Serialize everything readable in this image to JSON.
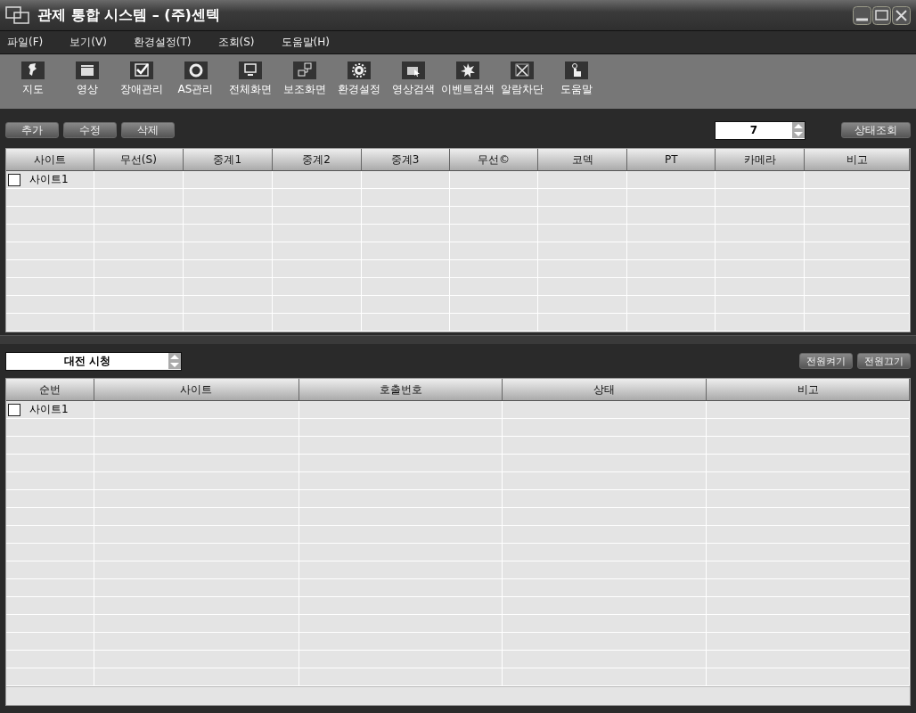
{
  "window": {
    "title": "관제 통합 시스템 – (주)센텍"
  },
  "menu": [
    "파일(F)",
    "보기(V)",
    "환경설정(T)",
    "조회(S)",
    "도움말(H)"
  ],
  "toolbar": [
    "지도",
    "영상",
    "장애관리",
    "AS관리",
    "전체화면",
    "보조화면",
    "환경설정",
    "영상검색",
    "이벤트검색",
    "알람차단",
    "도움말"
  ],
  "site_panel": {
    "buttons": [
      "추가",
      "수정",
      "삭제"
    ],
    "spinner_value": "7",
    "query_button": "상태조회",
    "columns": [
      "사이트",
      "무선(S)",
      "중계1",
      "중계2",
      "중계3",
      "무선©",
      "코덱",
      "PT",
      "카메라",
      "비고"
    ],
    "rows": [
      {
        "checked": false,
        "site": "사이트1"
      }
    ]
  },
  "power_panel": {
    "dropdown_value": "대전 시청",
    "buttons": [
      "전원켜기",
      "전원끄기"
    ],
    "columns": [
      "순번",
      "사이트",
      "호출번호",
      "상태",
      "비고"
    ],
    "rows": [
      {
        "checked": false,
        "site": "사이트1"
      }
    ]
  }
}
